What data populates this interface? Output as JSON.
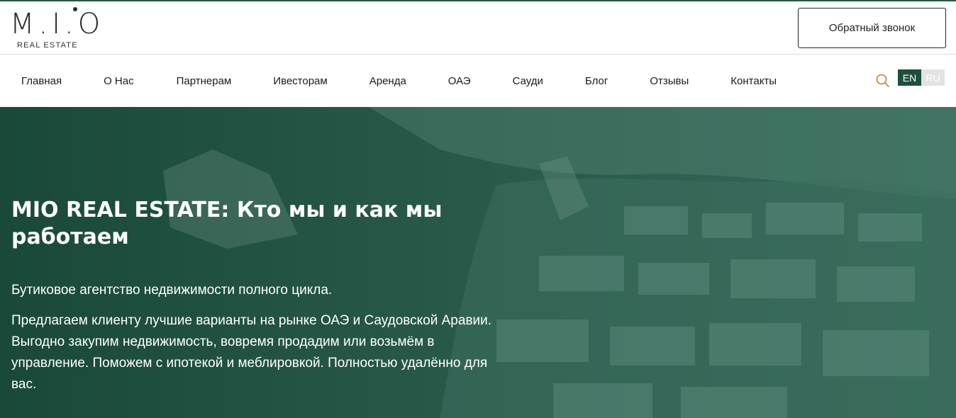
{
  "brand": {
    "logo_text": "M.I.O",
    "logo_subtitle": "REAL ESTATE"
  },
  "header": {
    "callback_label": "Обратный звонок"
  },
  "nav": {
    "items": [
      {
        "label": "Главная"
      },
      {
        "label": "О Нас"
      },
      {
        "label": "Партнерам"
      },
      {
        "label": "Ивесторам"
      },
      {
        "label": "Аренда"
      },
      {
        "label": "ОАЭ"
      },
      {
        "label": "Сауди"
      },
      {
        "label": "Блог"
      },
      {
        "label": "Отзывы"
      },
      {
        "label": "Контакты"
      }
    ],
    "search_icon": "search-icon",
    "languages": [
      {
        "code": "EN",
        "active": true
      },
      {
        "code": "RU",
        "active": false
      }
    ]
  },
  "hero": {
    "title": "MIO REAL ESTATE: Кто мы и как мы работаем",
    "lead": "Бутиковое агентство недвижимости полного цикла.",
    "text": "Предлагаем клиенту лучшие варианты на рынке ОАЭ и Саудовской Аравии. Выгодно закупим недвижимость, вовремя продадим или возьмём в управление. Поможем с ипотекой и меблировкой. Полностью удалённо для вас."
  },
  "colors": {
    "accent": "#1d4f3b",
    "search_icon": "#c0904e",
    "hero_overlay": "#1a4a3a"
  }
}
